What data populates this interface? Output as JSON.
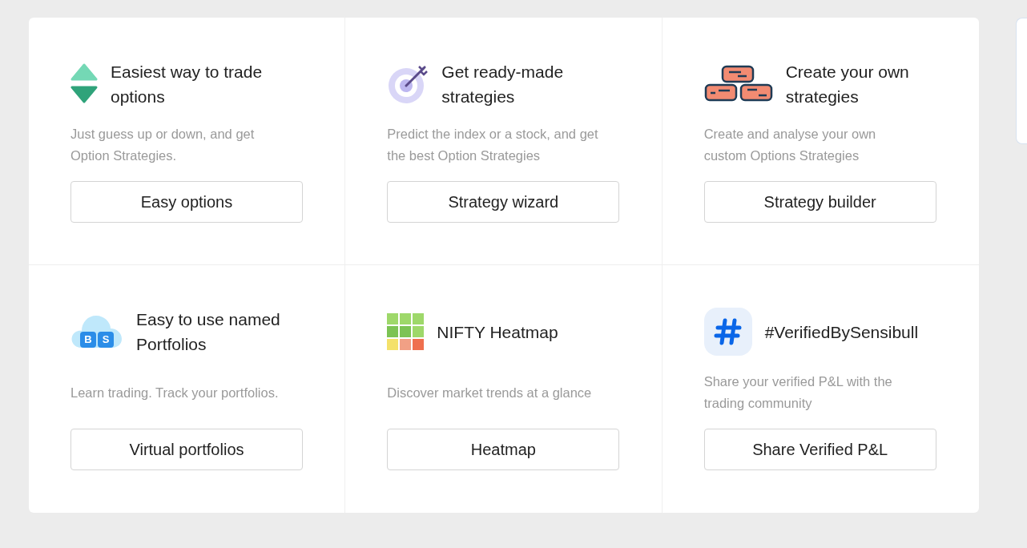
{
  "features": [
    {
      "kind": "updown",
      "title": "Easiest way to trade options",
      "description": "Just guess up or down, and get Option Strategies.",
      "button": "Easy options"
    },
    {
      "kind": "target",
      "title": "Get ready-made strategies",
      "description": "Predict the index or a stock, and get the best Option Strategies",
      "button": "Strategy wizard"
    },
    {
      "kind": "bricks",
      "title": "Create your own strategies",
      "description": "Create and analyse your own custom Options Strategies",
      "button": "Strategy builder"
    },
    {
      "kind": "cloud",
      "icon_letters": [
        "B",
        "S"
      ],
      "title": "Easy to use named Portfolios",
      "description": "Learn trading. Track your portfolios.",
      "button": "Virtual portfolios"
    },
    {
      "kind": "heatmap",
      "title": "NIFTY Heatmap",
      "description": "Discover market trends at a glance",
      "button": "Heatmap"
    },
    {
      "kind": "hash",
      "title": "#VerifiedBySensibull",
      "description": "Share your verified P&L with the trading community",
      "button": "Share Verified P&L"
    }
  ]
}
